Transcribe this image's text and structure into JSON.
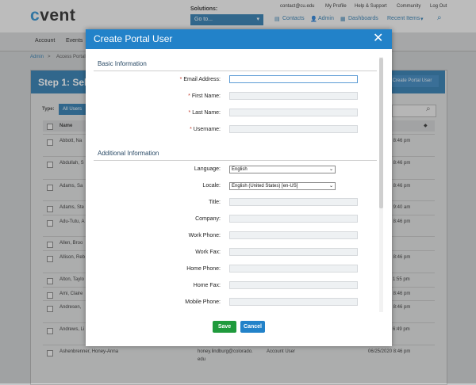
{
  "header": {
    "logo": "cvent",
    "solutions_label": "Solutions:",
    "solutions_select": "Go to...",
    "top_links": [
      "contact@cu.edu",
      "My Profile",
      "Help & Support",
      "Community",
      "Log Out"
    ],
    "nav_links": [
      "Contacts",
      "Admin",
      "Dashboards",
      "Recent Items"
    ]
  },
  "menu": [
    "Account",
    "Events"
  ],
  "breadcrumb": {
    "admin": "Admin",
    "sep": ">",
    "current": "Access Portal"
  },
  "page": {
    "step_title": "Step 1: Sele",
    "create_button": "Create Portal User",
    "type_label": "Type:",
    "all_users": "All Users",
    "name_header": "Name"
  },
  "rows": [
    {
      "name": "Abbott, Na",
      "date": "020 8:46 pm"
    },
    {
      "name": "Abdullah, S",
      "date": "020 8:46 pm"
    },
    {
      "name": "Adams, Sa",
      "date": "020 8:46 pm"
    },
    {
      "name": "Adams, Ste",
      "date": "020 9:40 am"
    },
    {
      "name": "Adu-Tutu, A",
      "date": "020 8:46 pm"
    },
    {
      "name": "Allen, Broo",
      "date": ""
    },
    {
      "name": "Allison, Reb",
      "date": "020 8:46 pm"
    },
    {
      "name": "Alton, Taylo",
      "date": "1:55 pm"
    },
    {
      "name": "Ami, Claire",
      "date": "020 8:46 pm"
    },
    {
      "name": "Andresen,",
      "date": "020 8:46 pm"
    },
    {
      "name": "Andrews, Li",
      "date": "6:49 pm"
    },
    {
      "name": "Ashenbrenner, Honey-Anna",
      "email": "honey.lindburg@colorado.",
      "email2": "edu",
      "type": "Account User",
      "date": "06/25/2020 8:46 pm"
    }
  ],
  "modal": {
    "title": "Create Portal User",
    "close_icon": "close-icon",
    "basic_section": "Basic Information",
    "additional_section": "Additional Information",
    "required_marker": "*",
    "fields_basic": [
      "Email Address:",
      "First Name:",
      "Last Name:",
      "Username:"
    ],
    "language_label": "Language:",
    "language_value": "English",
    "locale_label": "Locale:",
    "locale_value": "English (United States) [en-US]",
    "fields_additional": [
      "Title:",
      "Company:",
      "Work Phone:",
      "Work Fax:",
      "Home Phone:",
      "Home Fax:",
      "Mobile Phone:"
    ],
    "save_label": "Save",
    "cancel_label": "Cancel"
  },
  "colors": {
    "accent": "#2282c9",
    "save": "#1f9a3c",
    "required": "#c0392b"
  }
}
